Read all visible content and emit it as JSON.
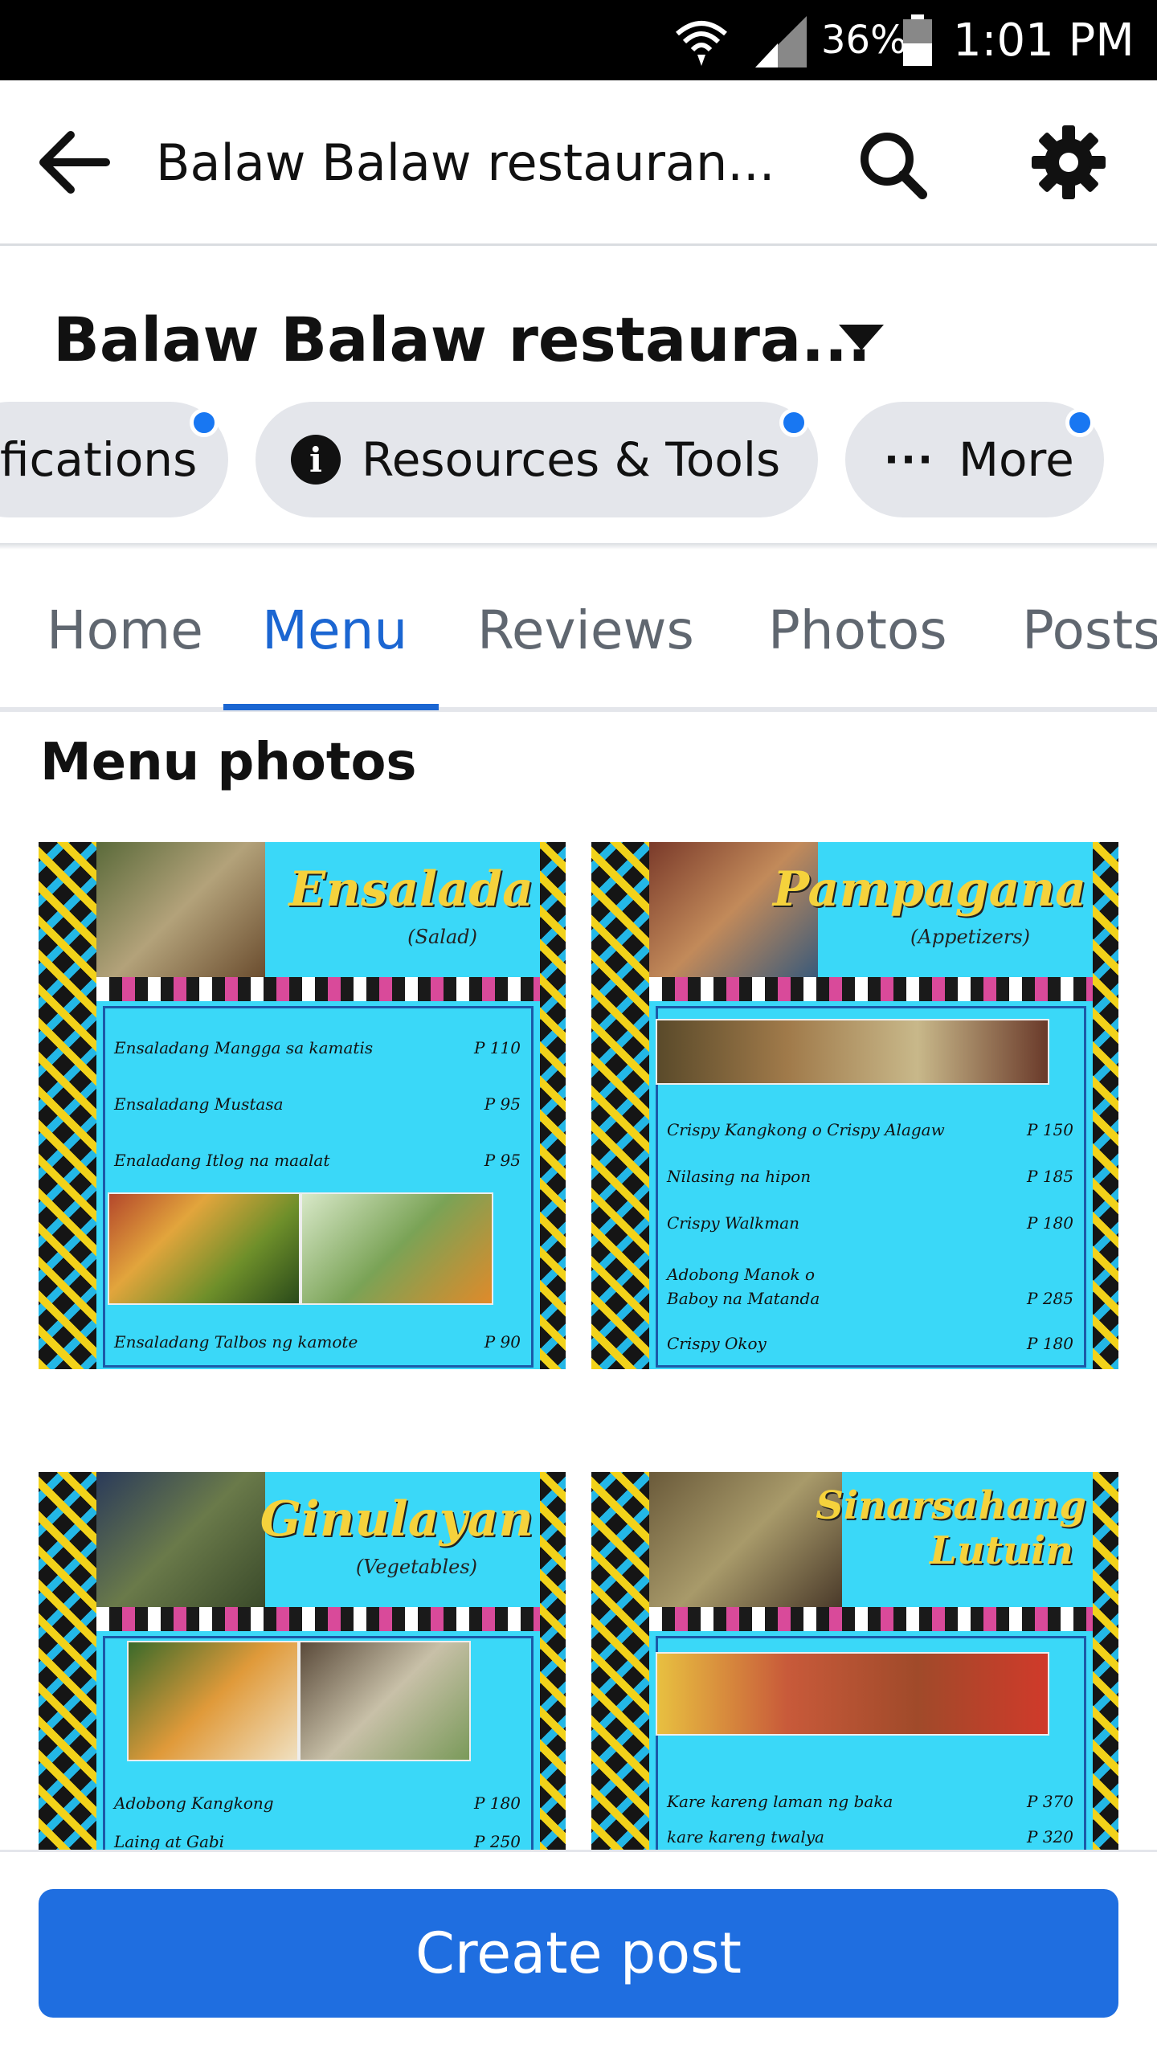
{
  "status_bar": {
    "battery_percent": "36%",
    "time": "1:01 PM",
    "icons": [
      "wifi-icon",
      "cell-signal-icon",
      "battery-icon"
    ]
  },
  "app_bar": {
    "title": "Balaw Balaw restauran...",
    "icons": [
      "back-arrow-icon",
      "search-icon",
      "gear-icon"
    ]
  },
  "page": {
    "name": "Balaw Balaw restaura...",
    "chips": [
      {
        "label": "fications",
        "has_dot": true
      },
      {
        "label": "Resources & Tools",
        "icon": "info-icon",
        "has_dot": true
      },
      {
        "label": "More",
        "icon": "more-dots-icon",
        "dots": "···",
        "has_dot": true
      }
    ]
  },
  "tabs": [
    {
      "label": "Home",
      "active": false
    },
    {
      "label": "Menu",
      "active": true
    },
    {
      "label": "Reviews",
      "active": false
    },
    {
      "label": "Photos",
      "active": false
    },
    {
      "label": "Posts",
      "active": false
    }
  ],
  "main": {
    "section_title": "Menu photos",
    "menu_photos": [
      {
        "title": "Ensalada",
        "subtitle": "(Salad)",
        "rows": [
          {
            "name": "Ensaladang Mangga sa kamatis",
            "price": "P 110"
          },
          {
            "name": "Ensaladang Mustasa",
            "price": "P 95"
          },
          {
            "name": "Enaladang Itlog na maalat",
            "price": "P 95"
          },
          {
            "name": "Ensaladang Talbos ng kamote",
            "price": "P 90"
          }
        ]
      },
      {
        "title": "Pampagana",
        "subtitle": "(Appetizers)",
        "rows": [
          {
            "name": "Crispy Kangkong o Crispy Alagaw",
            "price": "P 150"
          },
          {
            "name": "Nilasing na hipon",
            "price": "P 185"
          },
          {
            "name": "Crispy Walkman",
            "price": "P 180"
          },
          {
            "name": "Adobong Manok o",
            "price": ""
          },
          {
            "name": "Baboy na Matanda",
            "price": "P 285"
          },
          {
            "name": "Crispy Okoy",
            "price": "P 180"
          }
        ]
      },
      {
        "title": "Ginulayan",
        "subtitle": "(Vegetables)",
        "rows": [
          {
            "name": "Adobong Kangkong",
            "price": "P 180"
          },
          {
            "name": "Laing at Gabi",
            "price": "P 250"
          }
        ]
      },
      {
        "title": "Sinarsahang",
        "title2": "Lutuin",
        "rows": [
          {
            "name": "Kare kareng laman ng baka",
            "price": "P 370"
          },
          {
            "name": "kare kareng twalya",
            "price": "P 320"
          }
        ]
      }
    ]
  },
  "bottom_bar": {
    "create_post_label": "Create post"
  },
  "colors": {
    "accent_blue": "#1b66d2",
    "button_blue": "#1f6ee0",
    "chip_gray": "#e4e6eb",
    "notification_dot": "#1877f2",
    "menu_cyan": "#3ad8f8",
    "menu_yellow": "#f5d23c"
  }
}
